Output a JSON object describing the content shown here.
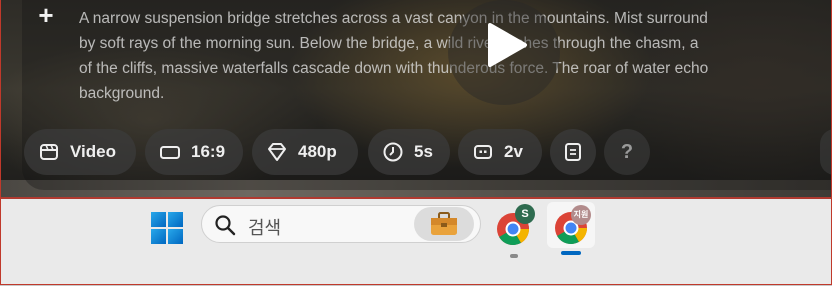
{
  "prompt": {
    "lines": [
      "A narrow suspension bridge stretches across a vast canyon in the mountains. Mist surround",
      "by soft rays of the morning sun. Below the bridge, a wild river rushes through the chasm, a",
      "of the cliffs, massive waterfalls cascade down with thunderous force. The roar of water echo",
      "background."
    ]
  },
  "toolbar": {
    "chips": [
      {
        "label": "Video",
        "icon": "video-icon"
      },
      {
        "label": "16:9",
        "icon": "aspect-ratio-icon"
      },
      {
        "label": "480p",
        "icon": "diamond-icon"
      },
      {
        "label": "5s",
        "icon": "clock-icon"
      },
      {
        "label": "2v",
        "icon": "variations-icon"
      }
    ],
    "help_label": "?"
  },
  "taskbar": {
    "search_placeholder": "검색",
    "apps": [
      {
        "name": "chrome-profile-s",
        "badge": "S"
      },
      {
        "name": "chrome-profile-2",
        "badge": "지원"
      }
    ]
  },
  "colors": {
    "accent_blue": "#0067c0",
    "taskbar_bg": "#eaeaea",
    "frame_red": "#c0392b"
  }
}
